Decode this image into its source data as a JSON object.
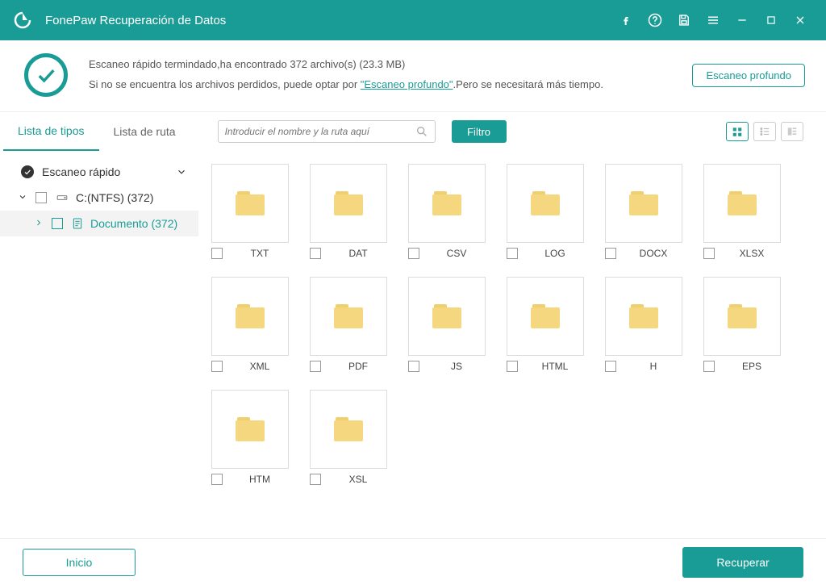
{
  "app": {
    "title": "FonePaw Recuperación de Datos"
  },
  "status": {
    "line1": "Escaneo rápido termindado,ha encontrado 372 archivo(s) (23.3 MB)",
    "line2a": "Si no se encuentra los archivos perdidos, puede optar por ",
    "link": "\"Escaneo profundo\"",
    "line2b": ".Pero se necesitará más tiempo.",
    "deep_scan": "Escaneo profundo"
  },
  "tabs": {
    "types": "Lista de tipos",
    "path": "Lista de ruta"
  },
  "search": {
    "placeholder": "Introducir el nombre y la ruta aquí"
  },
  "filter": "Filtro",
  "sidebar": {
    "head": "Escaneo rápido",
    "drive": "C:(NTFS) (372)",
    "doc": "Documento (372)"
  },
  "folders": [
    "TXT",
    "DAT",
    "CSV",
    "LOG",
    "DOCX",
    "XLSX",
    "XML",
    "PDF",
    "JS",
    "HTML",
    "H",
    "EPS",
    "HTM",
    "XSL"
  ],
  "footer": {
    "home": "Inicio",
    "recover": "Recuperar"
  }
}
